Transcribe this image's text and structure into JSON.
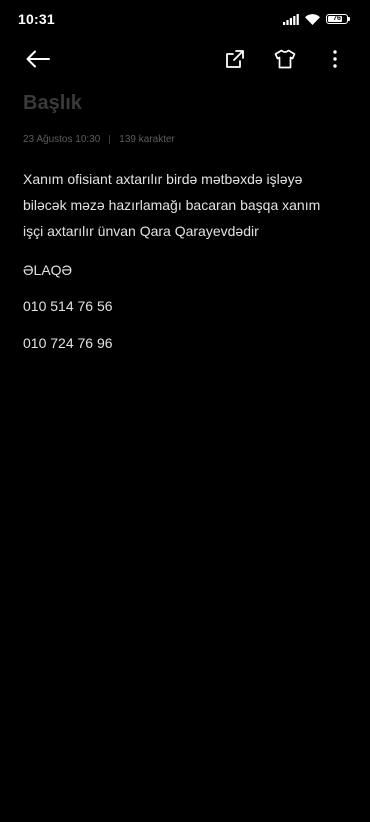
{
  "status_bar": {
    "time": "10:31",
    "battery_level": "76",
    "battery_fraction": 0.76,
    "icons": [
      "signal-icon",
      "wifi-icon",
      "battery-icon"
    ]
  },
  "toolbar": {
    "icons": [
      "back-arrow-icon",
      "share-icon",
      "tshirt-icon",
      "more-vertical-icon"
    ]
  },
  "note": {
    "title": "Başlık",
    "date": "23 Ağustos 10:30",
    "char_count": "139 karakter",
    "body": "Xanım ofisiant axtarılır birdə mətbəxdə işləyə biləcək məzə hazırlamağı bacaran başqa xanım işçi axtarılır ünvan Qara Qarayevdədir",
    "contact_label": "ƏLAQƏ",
    "phone_1": "010 514 76 56",
    "phone_2": "010 724 76 96"
  },
  "colors": {
    "background": "#000000",
    "text": "#e2e2e2",
    "title_placeholder": "#3a3a3a",
    "meta": "#5c5c5c"
  }
}
